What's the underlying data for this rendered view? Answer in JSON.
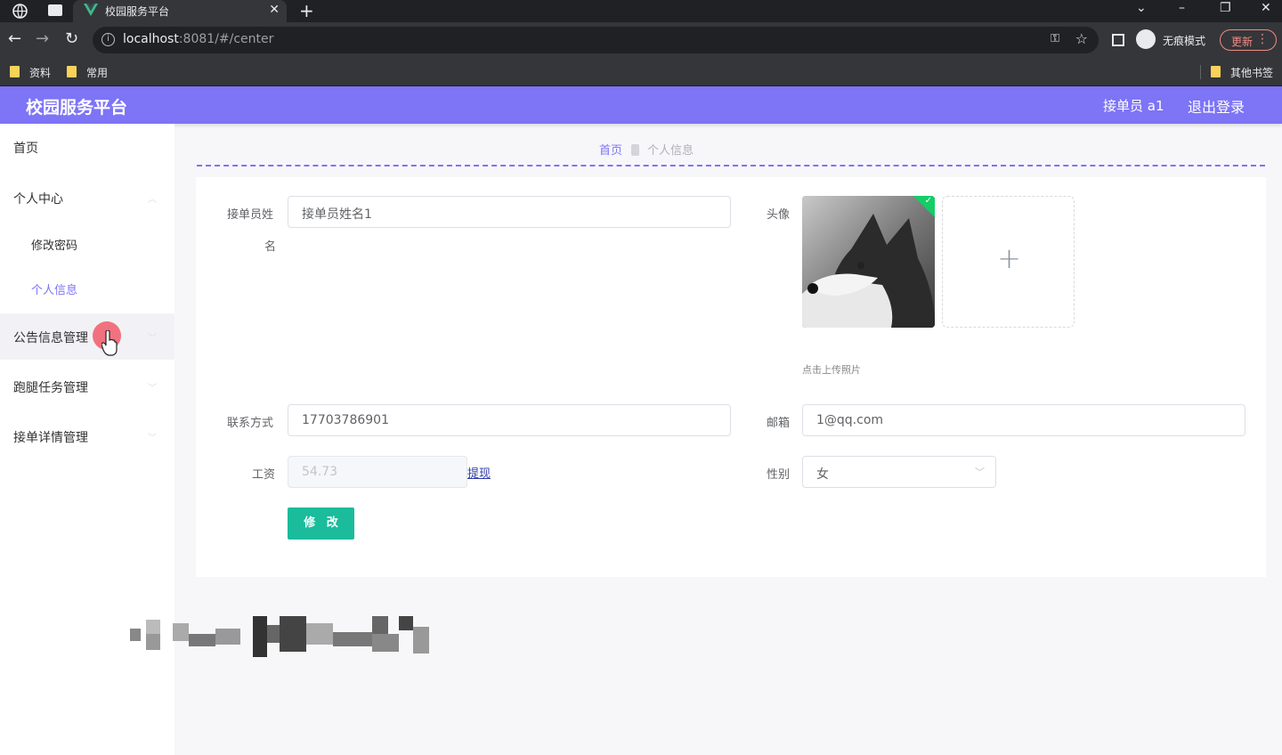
{
  "browser": {
    "tab_title": "校园服务平台",
    "url_host": "localhost",
    "url_path": ":8081/#/center",
    "incognito_label": "无痕模式",
    "update_label": "更新",
    "bookmarks": [
      "资料",
      "常用"
    ],
    "other_bookmarks": "其他书签"
  },
  "app": {
    "title": "校园服务平台",
    "user_label": "接单员 a1",
    "logout_label": "退出登录"
  },
  "sidebar": {
    "items": [
      {
        "label": "首页"
      },
      {
        "label": "个人中心"
      },
      {
        "label": "修改密码"
      },
      {
        "label": "个人信息"
      },
      {
        "label": "公告信息管理"
      },
      {
        "label": "跑腿任务管理"
      },
      {
        "label": "接单详情管理"
      }
    ]
  },
  "breadcrumb": {
    "home": "首页",
    "current": "个人信息"
  },
  "form": {
    "name_label_line1": "接单员姓",
    "name_label_line2": "名",
    "name_value": "接单员姓名1",
    "avatar_label": "头像",
    "upload_tip": "点击上传照片",
    "phone_label": "联系方式",
    "phone_value": "17703786901",
    "email_label": "邮箱",
    "email_value": "1@qq.com",
    "salary_label": "工资",
    "salary_value": "54.73",
    "withdraw_label": "提现",
    "gender_label": "性别",
    "gender_value": "女",
    "submit_label": "修 改"
  },
  "icons": {
    "upload": "plus-icon",
    "select": "chevron-down-icon",
    "success": "check-icon",
    "pointer": "hand-cursor-icon"
  },
  "colors": {
    "header": "#7d74f6",
    "accent": "#7d74f6",
    "button": "#1abc9c",
    "success": "#13ce66",
    "click_marker": "#f06a77"
  }
}
